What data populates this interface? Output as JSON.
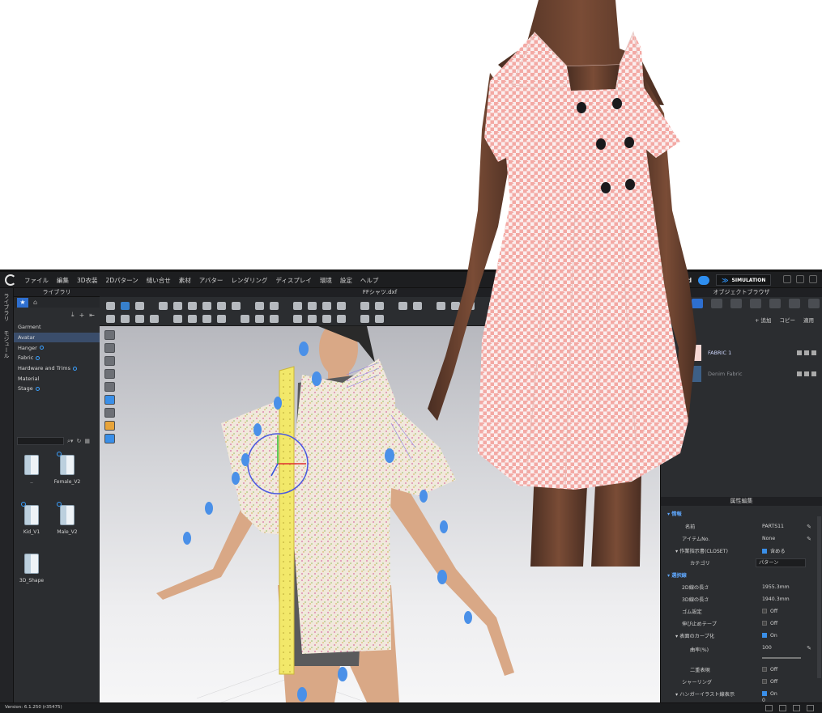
{
  "menu": {
    "items": [
      "ファイル",
      "編集",
      "3D衣装",
      "2Dパターン",
      "縫い合せ",
      "素材",
      "アバター",
      "レンダリング",
      "ディスプレイ",
      "環境",
      "設定",
      "ヘルプ"
    ],
    "user": "mkafc3d",
    "simulation_label": "SIMULATION"
  },
  "left_tabs": [
    "ライブラリ",
    "モジュール"
  ],
  "library": {
    "title": "ライブラリ",
    "categories": [
      "Garment",
      "Avatar",
      "Hanger",
      "Fabric",
      "Hardware and Trims",
      "Material",
      "Stage"
    ],
    "selected_category": "Avatar",
    "folders": [
      "..",
      "Female_V2",
      "Kid_V1",
      "Male_V2",
      "3D_Shape"
    ]
  },
  "document": {
    "title": "FFシャツ.dxf"
  },
  "object_browser": {
    "title": "オブジェクトブラウザ",
    "add_label": "+ 追加",
    "copy_label": "コピー",
    "apply_label": "適用",
    "fabrics": [
      {
        "name": "FABRIC 1",
        "color": "#f6d8d4"
      },
      {
        "name": "Denim Fabric",
        "color": "#3d5f86"
      }
    ]
  },
  "properties": {
    "title": "属性編集",
    "info_section": "情報",
    "name_label": "名前",
    "name_value": "PARTS11",
    "item_no_label": "アイテムNo.",
    "item_no_value": "None",
    "closet_label": "作業指示書(CLOSET)",
    "closet_value": "含める",
    "category_label": "カテゴリ",
    "category_value": "パターン",
    "line_section": "選択線",
    "len2d_label": "2D線の長さ",
    "len2d_value": "1955.3mm",
    "len3d_label": "3D線の長さ",
    "len3d_value": "1940.3mm",
    "elastic_label": "ゴム設定",
    "elastic_value": "Off",
    "tape_label": "伸び止めテープ",
    "tape_value": "Off",
    "curve_label": "表面のカーブ化",
    "curve_value": "On",
    "curvature_label": "曲率(%)",
    "curvature_value": "100",
    "double_label": "二重表現",
    "double_value": "Off",
    "shirring_label": "シャーリング",
    "shirring_value": "Off",
    "hanger_label": "ハンガーイラスト線表示",
    "hanger_value": "On",
    "last_value": "0"
  },
  "status": {
    "version": "Version: 6.1.250 (r35475)"
  },
  "colors": {
    "accent": "#2e8ef0",
    "panel_bg": "#2b2d30",
    "dress_pink": "#f3a9a4"
  }
}
